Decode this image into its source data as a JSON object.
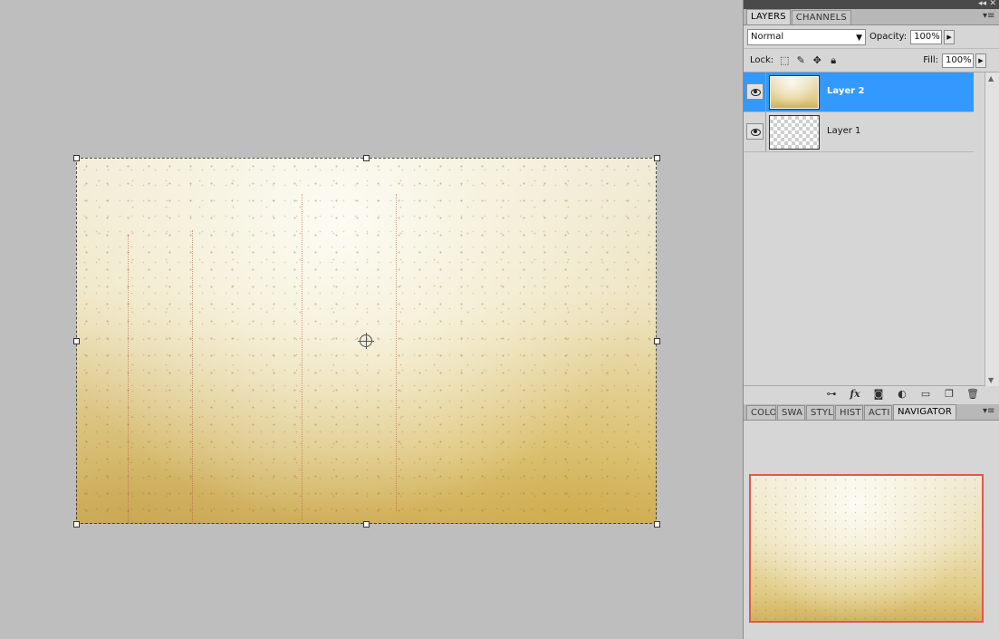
{
  "dock": {
    "collapse_glyph": "◂◂",
    "close_glyph": "✕"
  },
  "layers_panel": {
    "tabs": [
      {
        "label": "LAYERS",
        "active": true
      },
      {
        "label": "CHANNELS",
        "active": false
      }
    ],
    "menu_glyph": "▾≡",
    "blend_mode": "Normal",
    "opacity_label": "Opacity:",
    "opacity_value": "100%",
    "lock_label": "Lock:",
    "fill_label": "Fill:",
    "fill_value": "100%",
    "layers": [
      {
        "name": "Layer 2",
        "selected": true,
        "visible": true,
        "thumbnail": "texture"
      },
      {
        "name": "Layer 1",
        "selected": false,
        "visible": true,
        "thumbnail": "transparent"
      }
    ],
    "footer_icons": [
      "link-icon",
      "fx-icon",
      "mask-icon",
      "adjustment-icon",
      "folder-icon",
      "new-layer-icon",
      "trash-icon"
    ]
  },
  "nav_panel": {
    "tabs": [
      {
        "label": "COLO",
        "active": false
      },
      {
        "label": "SWA",
        "active": false
      },
      {
        "label": "STYL",
        "active": false
      },
      {
        "label": "HIST",
        "active": false
      },
      {
        "label": "ACTI",
        "active": false
      },
      {
        "label": "NAVIGATOR",
        "active": true
      }
    ],
    "menu_glyph": "▾≡",
    "view_box_color": "#e0584e"
  },
  "colors": {
    "selection_blue": "#3399ff",
    "workspace_gray": "#bebebe",
    "panel_gray": "#d6d6d6"
  }
}
